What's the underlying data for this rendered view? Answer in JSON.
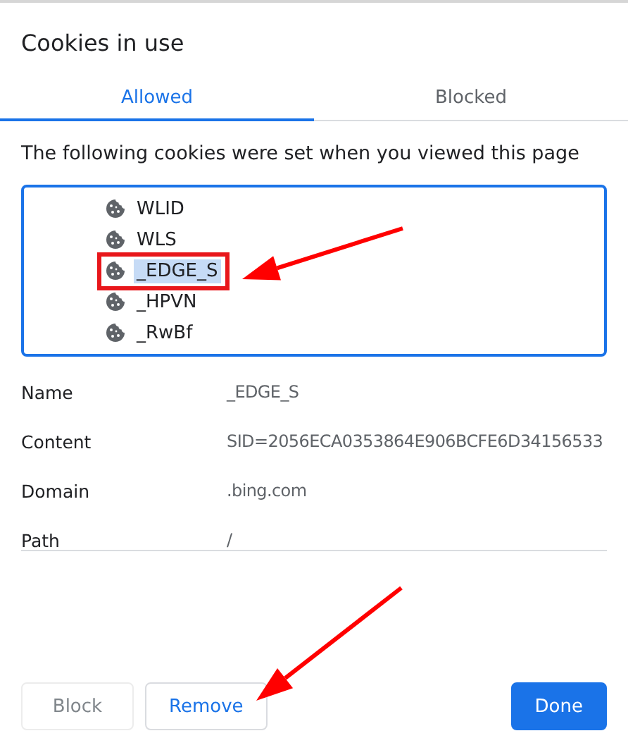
{
  "dialog": {
    "title": "Cookies in use"
  },
  "tabs": [
    {
      "label": "Allowed",
      "selected": true
    },
    {
      "label": "Blocked",
      "selected": false
    }
  ],
  "description": "The following cookies were set when you viewed this page",
  "cookies": [
    {
      "name": "WLID",
      "selected": false,
      "marked": false
    },
    {
      "name": "WLS",
      "selected": false,
      "marked": false
    },
    {
      "name": "_EDGE_S",
      "selected": true,
      "marked": true
    },
    {
      "name": "_HPVN",
      "selected": false,
      "marked": false
    },
    {
      "name": "_RwBf",
      "selected": false,
      "marked": false
    }
  ],
  "details": [
    {
      "label": "Name",
      "value": "_EDGE_S"
    },
    {
      "label": "Content",
      "value": "SID=2056ECA0353864E906BCFE6D34156533"
    },
    {
      "label": "Domain",
      "value": ".bing.com"
    },
    {
      "label": "Path",
      "value": "/"
    }
  ],
  "buttons": [
    {
      "label": "Block",
      "kind": "secondary",
      "disabled": true
    },
    {
      "label": "Remove",
      "kind": "secondary",
      "disabled": false
    },
    {
      "label": "Done",
      "kind": "primary",
      "disabled": false
    }
  ]
}
